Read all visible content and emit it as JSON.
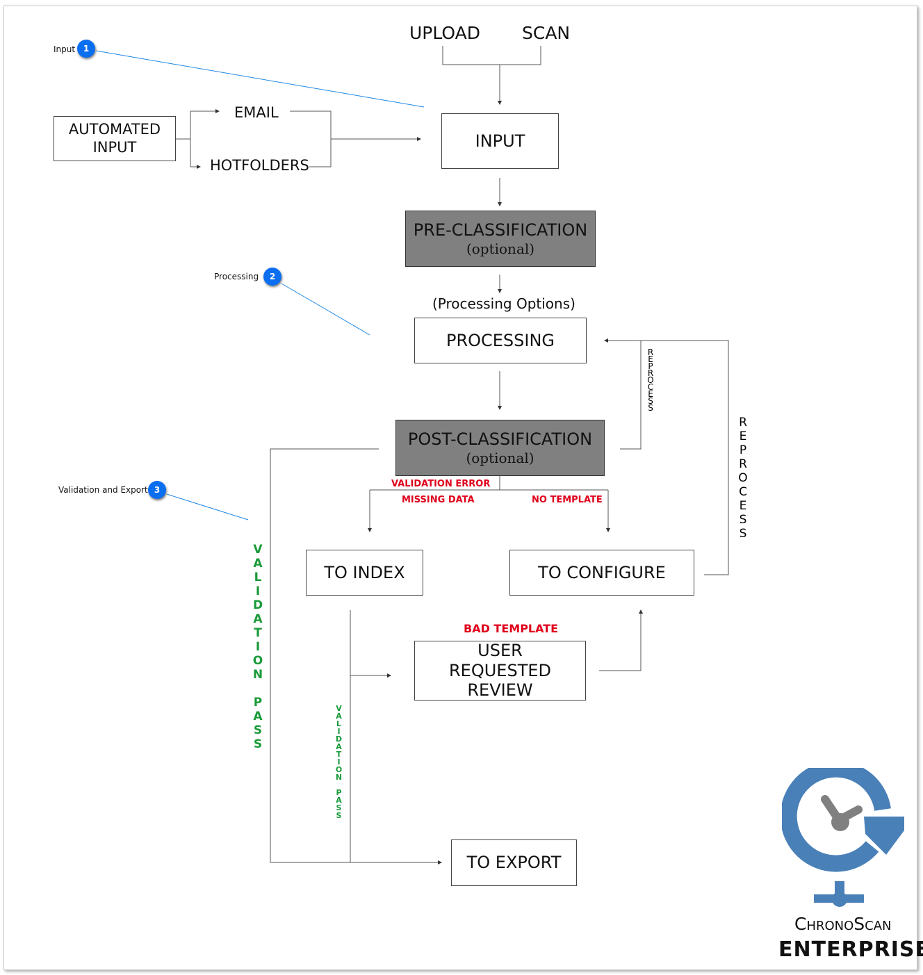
{
  "sources": {
    "upload": "UPLOAD",
    "scan": "SCAN",
    "email": "EMAIL",
    "hotfolders": "HOTFOLDERS"
  },
  "boxes": {
    "automated_input": "AUTOMATED INPUT",
    "input": "INPUT",
    "pre_classification": "PRE-CLASSIFICATION",
    "pre_optional": "(optional)",
    "processing_options": "(Processing Options)",
    "processing": "PROCESSING",
    "post_classification": "POST-CLASSIFICATION",
    "post_optional": "(optional)",
    "to_index": "TO INDEX",
    "to_configure": "TO CONFIGURE",
    "user_review": "USER REQUESTED REVIEW",
    "to_export": "TO EXPORT"
  },
  "labels": {
    "validation_error": "VALIDATION ERROR",
    "missing_data": "MISSING DATA",
    "no_template": "NO TEMPLATE",
    "bad_template": "BAD TEMPLATE",
    "reprocess_inner": "REPROCESS",
    "reprocess_outer": "REPROCESS",
    "validation_pass_large": "VALIDATION PASS",
    "validation_pass_small": "VALIDATION PASS"
  },
  "callouts": [
    {
      "number": "1",
      "label": "Input"
    },
    {
      "number": "2",
      "label": "Processing"
    },
    {
      "number": "3",
      "label": "Validation and Export"
    }
  ],
  "logo": {
    "name": "ChronoScan",
    "edition": "ENTERPRISE"
  },
  "colors": {
    "callout": "#0a6ef0",
    "error": "#e0001b",
    "pass": "#1a9a3a",
    "logo": "#4a80b8",
    "box_gray": "#808080"
  }
}
